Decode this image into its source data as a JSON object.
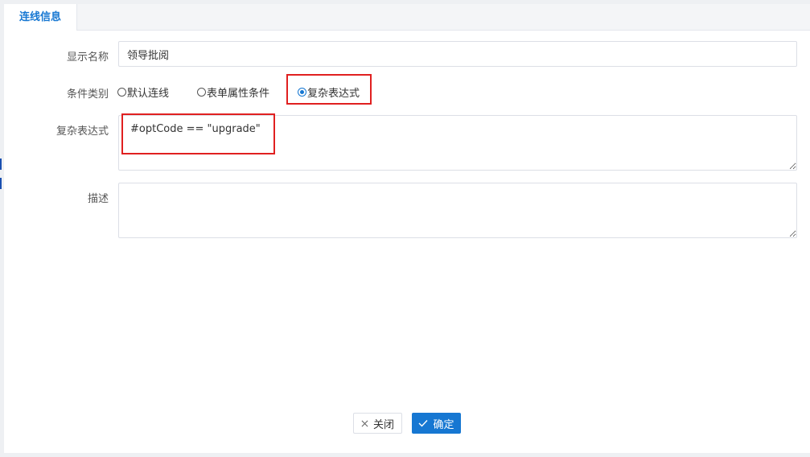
{
  "tab": {
    "label": "连线信息"
  },
  "form": {
    "display_name": {
      "label": "显示名称",
      "value": "领导批阅"
    },
    "condition_type": {
      "label": "条件类别",
      "options": [
        "默认连线",
        "表单属性条件",
        "复杂表达式"
      ],
      "selected": "复杂表达式"
    },
    "expression": {
      "label": "复杂表达式",
      "value": "#optCode == \"upgrade\""
    },
    "description": {
      "label": "描述",
      "value": ""
    }
  },
  "buttons": {
    "close_label": "关闭",
    "confirm_label": "确定"
  },
  "icons": {
    "close": "close-x-icon",
    "confirm": "checkmark-icon"
  },
  "colors": {
    "accent": "#1677d2",
    "highlight": "#e02020"
  }
}
